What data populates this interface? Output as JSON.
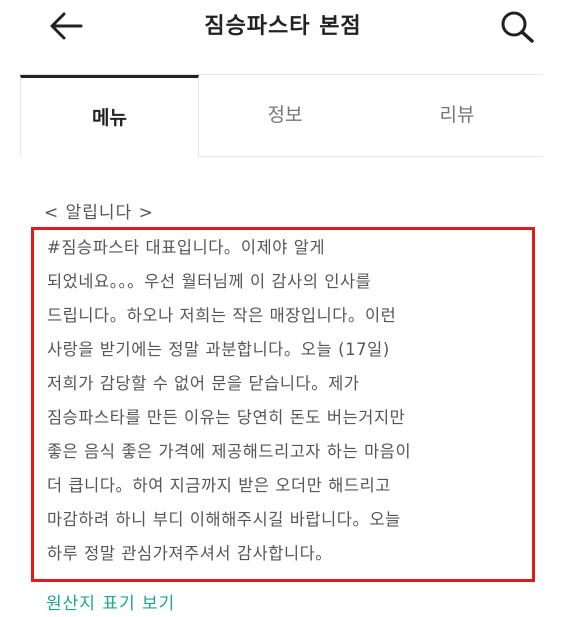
{
  "header": {
    "title": "짐승파스타 본점",
    "back_icon": "arrow-left-icon",
    "search_icon": "search-icon"
  },
  "tabs": [
    {
      "label": "메뉴",
      "active": true
    },
    {
      "label": "정보",
      "active": false
    },
    {
      "label": "리뷰",
      "active": false
    }
  ],
  "notice": {
    "heading": "< 알립니다 >",
    "lines": [
      "#짐승파스타 대표입니다。이제야 알게",
      "되었네요。。。우선 월터님께 이 감사의 인사를",
      "드립니다。하오나 저희는 작은 매장입니다。이런",
      "사랑을 받기에는 정말 과분합니다。오늘 (17일)",
      "저희가 감당할 수 없어 문을 닫습니다。제가",
      "짐승파스타를 만든 이유는 당연히 돈도 버는거지만",
      "좋은 음식 좋은 가격에 제공해드리고자 하는 마음이",
      "더 큽니다。하여 지금까지 받은 오더만 해드리고",
      "마감하려 하니 부디 이해해주시길 바랍니다。오늘",
      "하루 정말 관심가져주셔서 감사합니다。"
    ],
    "highlight_color": "#e01b1b"
  },
  "footer": {
    "origin_link": "원산지 표기 보기",
    "link_color": "#1fa58f"
  }
}
